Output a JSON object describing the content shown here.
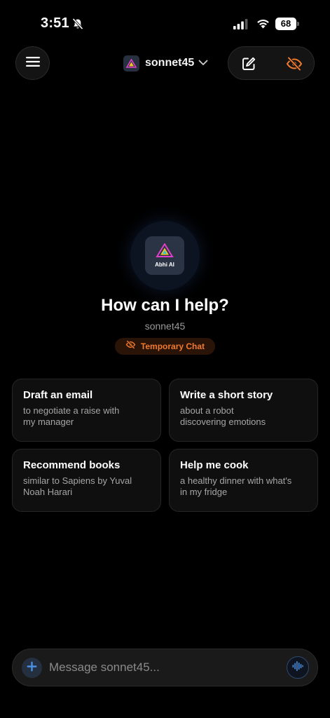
{
  "status_bar": {
    "time": "3:51",
    "battery": "68",
    "icons": [
      "bell-slash-icon",
      "cellular-signal-icon",
      "wifi-icon",
      "battery-icon"
    ]
  },
  "header": {
    "menu_icon": "hamburger-menu-icon",
    "model": {
      "name": "sonnet45",
      "dropdown_icon": "chevron-down-icon"
    },
    "actions": [
      {
        "name": "new-chat",
        "icon": "compose-icon"
      },
      {
        "name": "temporary-chat-toggle",
        "icon": "eye-slash-icon",
        "active_color": "#f07a2e"
      }
    ]
  },
  "hero": {
    "logo_text": "Abhi AI",
    "title": "How can I help?",
    "subtitle": "sonnet45",
    "chip": {
      "label": "Temporary Chat",
      "icon": "eye-slash-icon",
      "color": "#f07a2e"
    }
  },
  "suggestions": [
    {
      "title": "Draft an email",
      "desc_line1": "to negotiate a raise with",
      "desc_line2": "my manager"
    },
    {
      "title": "Write a short story",
      "desc_line1": "about a robot",
      "desc_line2": "discovering emotions"
    },
    {
      "title": "Recommend books",
      "desc_line1": "similar to Sapiens by Yuval",
      "desc_line2": "Noah Harari"
    },
    {
      "title": "Help me cook",
      "desc_line1": "a healthy dinner with what's",
      "desc_line2": "in my fridge"
    }
  ],
  "composer": {
    "placeholder": "Message sonnet45...",
    "value": "",
    "plus_icon": "plus-icon",
    "voice_icon": "voice-waveform-icon",
    "accent": "#4a90e2"
  }
}
